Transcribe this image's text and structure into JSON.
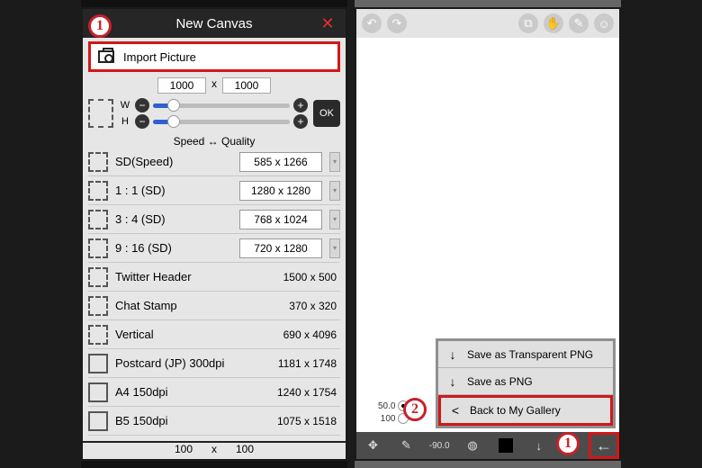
{
  "colors": {
    "highlight": "#d01818",
    "badge": "#c8202a"
  },
  "left": {
    "title": "New Canvas",
    "close_glyph": "✕",
    "badge": "1",
    "import_label": "Import Picture",
    "top_dims": {
      "w": "1000",
      "sep": "x",
      "h": "1000"
    },
    "sliders": {
      "w_label": "W",
      "h_label": "H",
      "minus": "−",
      "plus": "+"
    },
    "ok": "OK",
    "sq_label": "Speed ↔ Quality",
    "presets_editable": [
      {
        "name": "SD(Speed)",
        "value": "585 x 1266"
      },
      {
        "name": "1 : 1 (SD)",
        "value": "1280 x 1280"
      },
      {
        "name": "3 : 4 (SD)",
        "value": "768 x 1024"
      },
      {
        "name": "9 : 16 (SD)",
        "value": "720 x 1280"
      }
    ],
    "presets_static": [
      {
        "name": "Twitter Header",
        "value": "1500 x 500",
        "dashed": true
      },
      {
        "name": "Chat Stamp",
        "value": "370 x 320",
        "dashed": true
      },
      {
        "name": "Vertical",
        "value": "690 x 4096",
        "dashed": true
      },
      {
        "name": "Postcard (JP) 300dpi",
        "value": "1181 x 1748",
        "dashed": false
      },
      {
        "name": "A4 150dpi",
        "value": "1240 x 1754",
        "dashed": false
      },
      {
        "name": "B5 150dpi",
        "value": "1075 x 1518",
        "dashed": false
      }
    ],
    "foot": {
      "w": "100",
      "sep": "x",
      "h": "100"
    }
  },
  "right": {
    "badge_menu": "2",
    "badge_back": "1",
    "zoom": {
      "line1": "50.0",
      "line2": "100"
    },
    "menu": [
      {
        "icon": "↓",
        "label": "Save as Transparent PNG",
        "hl": false
      },
      {
        "icon": "↓",
        "label": "Save as PNG",
        "hl": false
      },
      {
        "icon": "<",
        "label": "Back to My Gallery",
        "hl": true
      }
    ],
    "bottom_tools": {
      "angle": "-90.0",
      "arrow_down": "↓",
      "arrow_up": "↑",
      "back": "←"
    },
    "top_icons": [
      "undo-icon",
      "redo-icon",
      "copy-icon",
      "paste-icon",
      "edit-icon",
      "user-icon"
    ]
  }
}
